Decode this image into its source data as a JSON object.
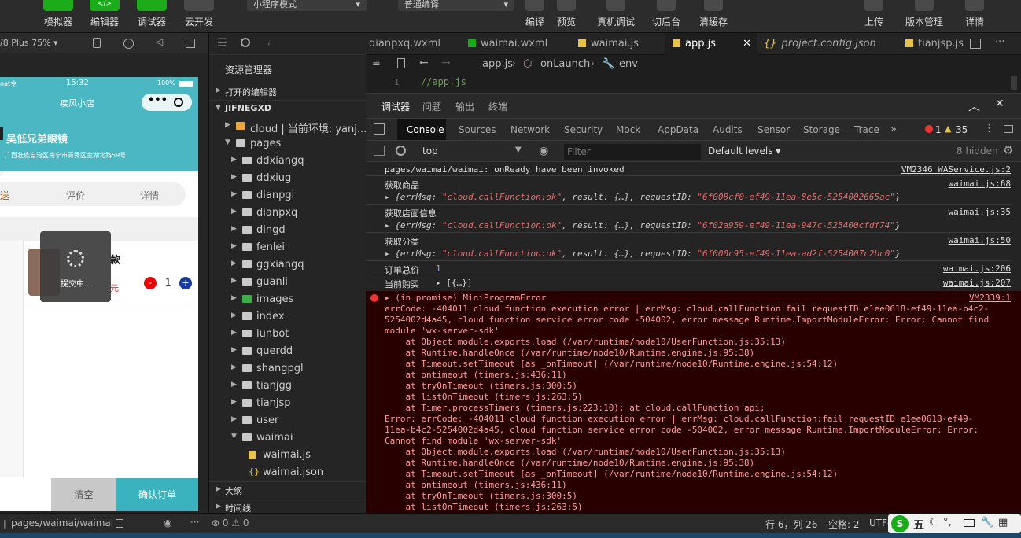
{
  "toolbar": {
    "buttons": [
      {
        "label": "模拟器"
      },
      {
        "label": "编辑器"
      },
      {
        "label": "调试器"
      },
      {
        "label": "云开发"
      }
    ],
    "mode_select": "小程序模式",
    "compile_select": "普通编译",
    "actions": [
      {
        "label": "编译"
      },
      {
        "label": "预览"
      },
      {
        "label": "真机调试"
      },
      {
        "label": "切后台"
      },
      {
        "label": "清缓存"
      }
    ],
    "right": [
      {
        "label": "上传"
      },
      {
        "label": "版本管理"
      },
      {
        "label": "详情"
      }
    ]
  },
  "simulator": {
    "device": "/8 Plus 75% ▾",
    "status_carrier": "nat令",
    "status_time": "15:32",
    "status_battery": "100%",
    "nav_title": "疾风小店",
    "shop_name": "吴低兄弟眼镜",
    "shop_address": "广西壮族自治区南宁市青秀区金湖北路59号",
    "tabs": [
      "送",
      "评价",
      "详情"
    ],
    "product_name": "款",
    "product_price": "元",
    "qty": "1",
    "loading_text": "提交中...",
    "btn_clear": "清空",
    "btn_confirm": "确认订单"
  },
  "simfoot": {
    "path": "pages/waimai/waimai",
    "counts": "⊗ 0 ⚠ 0"
  },
  "explorer": {
    "title": "资源管理器",
    "open_editors": "打开的编辑器",
    "project": "JIFNEGXD",
    "items": [
      {
        "label": "cloud | 当前环境: yanj...",
        "type": "folder"
      },
      {
        "label": "pages",
        "type": "folder-open"
      },
      {
        "label": "ddxiangq",
        "type": "folder"
      },
      {
        "label": "ddxiug",
        "type": "folder"
      },
      {
        "label": "dianpgl",
        "type": "folder"
      },
      {
        "label": "dianpxq",
        "type": "folder"
      },
      {
        "label": "dingd",
        "type": "folder"
      },
      {
        "label": "fenlei",
        "type": "folder"
      },
      {
        "label": "ggxiangq",
        "type": "folder"
      },
      {
        "label": "guanli",
        "type": "folder"
      },
      {
        "label": "images",
        "type": "folder"
      },
      {
        "label": "index",
        "type": "folder"
      },
      {
        "label": "lunbot",
        "type": "folder"
      },
      {
        "label": "querdd",
        "type": "folder"
      },
      {
        "label": "shangpgl",
        "type": "folder"
      },
      {
        "label": "tianjgg",
        "type": "folder"
      },
      {
        "label": "tianjsp",
        "type": "folder"
      },
      {
        "label": "user",
        "type": "folder"
      },
      {
        "label": "waimai",
        "type": "folder-open"
      },
      {
        "label": "waimai.js",
        "type": "js"
      },
      {
        "label": "waimai.json",
        "type": "json"
      }
    ],
    "outline": "大纲",
    "timeline": "时间线"
  },
  "editor": {
    "tabs": [
      {
        "label": "dianpxq.wxml"
      },
      {
        "label": "waimai.wxml"
      },
      {
        "label": "waimai.js"
      },
      {
        "label": "app.js"
      },
      {
        "label": "project.config.json"
      },
      {
        "label": "tianjsp.js"
      }
    ],
    "close": "✕",
    "crumbs": [
      "app.js",
      "onLaunch",
      "env"
    ],
    "line_no": "1",
    "code": "//app.js"
  },
  "devtools": {
    "panel_tabs": [
      "调试器",
      "问题",
      "输出",
      "终端"
    ],
    "tabs": [
      "Console",
      "Sources",
      "Network",
      "Security",
      "Mock",
      "AppData",
      "Audits",
      "Sensor",
      "Storage",
      "Trace",
      "»"
    ],
    "err_count": "1",
    "warn_count": "35",
    "context": "top",
    "filter_placeholder": "Filter",
    "levels": "Default levels ▾",
    "hidden": "8 hidden"
  },
  "console": {
    "logs": [
      {
        "text": "pages/waimai/waimai: onReady have been invoked",
        "src": "VM2346 WAService.js:2"
      },
      {
        "text": "获取商品",
        "src": "waimai.js:68",
        "obj_pre": "▸ {errMsg: ",
        "obj_s1": "\"cloud.callFunction:ok\"",
        "obj_mid": ", result: {…}, requestID: ",
        "obj_s2": "\"6f008cf0-ef49-11ea-8e5c-5254002665ac\"",
        "obj_end": "}"
      },
      {
        "text": "获取店面信息",
        "src": "waimai.js:35",
        "obj_pre": "▸ {errMsg: ",
        "obj_s1": "\"cloud.callFunction:ok\"",
        "obj_mid": ", result: {…}, requestID: ",
        "obj_s2": "\"6f02a959-ef49-11ea-947c-525400cfdf74\"",
        "obj_end": "}"
      },
      {
        "text": "获取分类",
        "src": "waimai.js:50",
        "obj_pre": "▸ {errMsg: ",
        "obj_s1": "\"cloud.callFunction:ok\"",
        "obj_mid": ", result: {…}, requestID: ",
        "obj_s2": "\"6f000c95-ef49-11ea-ad2f-5254007c2bc0\"",
        "obj_end": "}"
      },
      {
        "text": "订单总价 ",
        "val": "1",
        "src": "waimai.js:206"
      },
      {
        "text": "当前购买 ",
        "val": "▸ [{…}]",
        "src": "waimai.js:207"
      }
    ],
    "error_head": "▸ (in promise) MiniProgramError",
    "error_src": "VM2339:1",
    "error_lines": [
      "errCode: -404011 cloud function execution error | errMsg: cloud.callFunction:fail requestID e1ee0618-ef49-11ea-b4c2-",
      "5254002d4a45, cloud function service error code -504002, error message Runtime.ImportModuleError: Error: Cannot find",
      "module 'wx-server-sdk'",
      "    at Object.module.exports.load (/var/runtime/node10/UserFunction.js:35:13)",
      "    at Runtime.handleOnce (/var/runtime/node10/Runtime.engine.js:95:38)",
      "    at Timeout.setTimeout [as _onTimeout] (/var/runtime/node10/Runtime.engine.js:54:12)",
      "    at ontimeout (timers.js:436:11)",
      "    at tryOnTimeout (timers.js:300:5)",
      "    at listOnTimeout (timers.js:263:5)",
      "    at Timer.processTimers (timers.js:223:10); at cloud.callFunction api;",
      "Error: errCode: -404011 cloud function execution error | errMsg: cloud.callFunction:fail requestID e1ee0618-ef49-",
      "11ea-b4c2-5254002d4a45, cloud function service error code -504002, error message Runtime.ImportModuleError: Error:",
      "Cannot find module 'wx-server-sdk'",
      "    at Object.module.exports.load (/var/runtime/node10/UserFunction.js:35:13)",
      "    at Runtime.handleOnce (/var/runtime/node10/Runtime.engine.js:95:38)",
      "    at Timeout.setTimeout [as _onTimeout] (/var/runtime/node10/Runtime.engine.js:54:12)",
      "    at ontimeout (timers.js:436:11)",
      "    at tryOnTimeout (timers.js:300:5)",
      "    at listOnTimeout (timers.js:263:5)"
    ]
  },
  "status": {
    "pos": "行 6，列 26",
    "spaces": "空格: 2",
    "enc": "UTF-",
    "ime": "五"
  }
}
